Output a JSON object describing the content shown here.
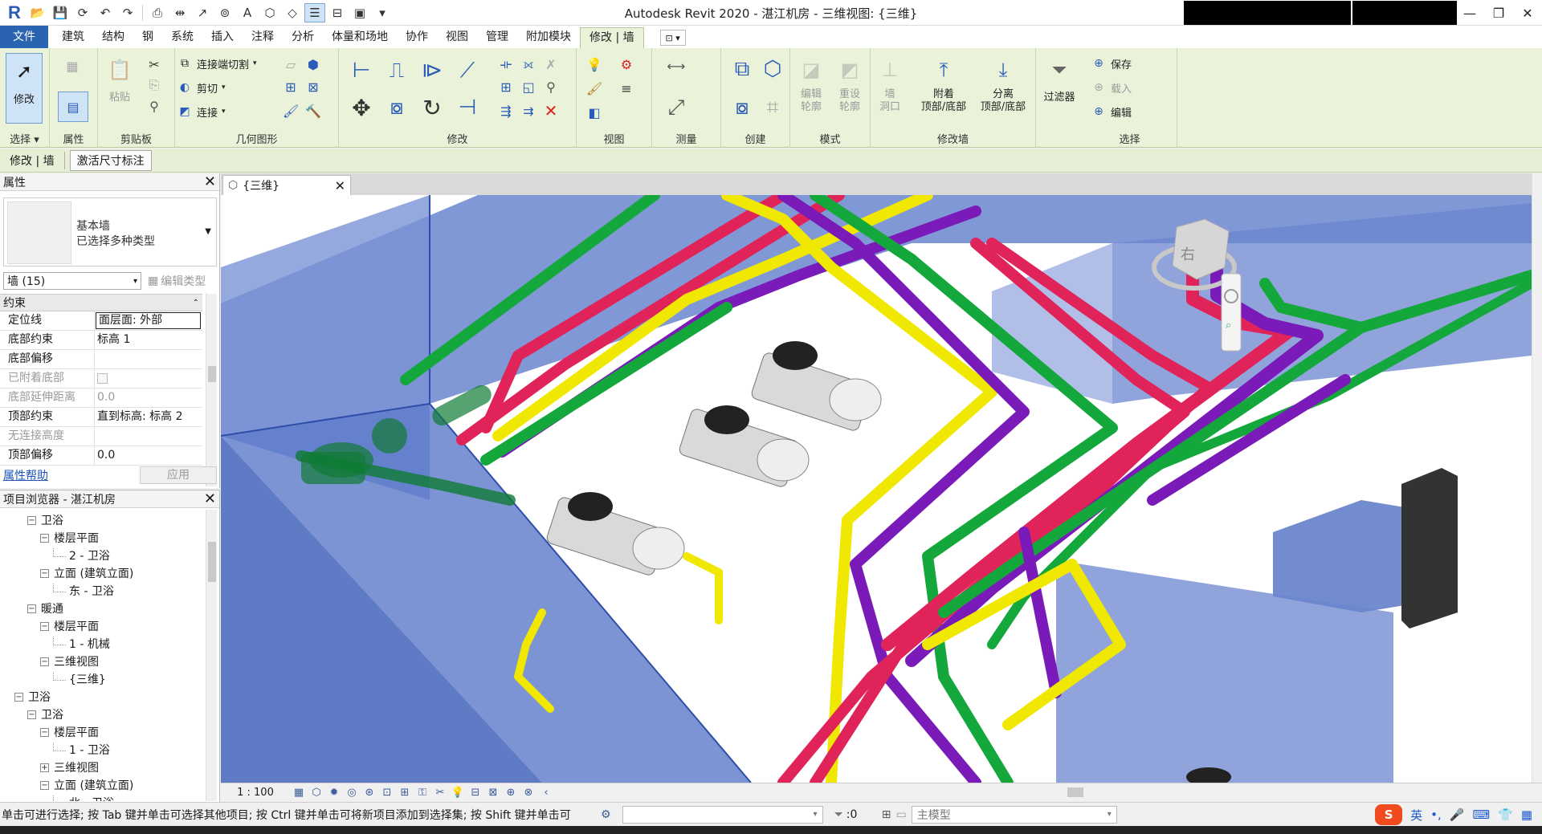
{
  "app": {
    "title": "Autodesk Revit 2020 - 湛江机房 - 三维视图: {三维}"
  },
  "quick_access": {
    "icons": [
      "revit-logo",
      "open-icon",
      "save-icon",
      "sync-icon",
      "undo-icon",
      "redo-icon",
      "print-icon",
      "measure-icon",
      "dimension-icon",
      "tag-icon",
      "text-icon",
      "3d-view-icon",
      "section-icon",
      "thin-lines-icon",
      "close-hidden-icon",
      "switch-windows-icon",
      "customize-icon"
    ],
    "text_glyph": "A"
  },
  "window_controls": {
    "minimize": "—",
    "restore": "❐",
    "close": "✕"
  },
  "tabs": [
    "文件",
    "建筑",
    "结构",
    "钢",
    "系统",
    "插入",
    "注释",
    "分析",
    "体量和场地",
    "协作",
    "视图",
    "管理",
    "附加模块",
    "修改 | 墙"
  ],
  "tabs_selected_index": 13,
  "tab_extra": "⊡ ▾",
  "ribbon": {
    "select": {
      "modify_label": "修改",
      "panel_label": "选择 ▾"
    },
    "properties": {
      "panel_label": "属性"
    },
    "clipboard": {
      "paste_label": "粘贴",
      "panel_label": "剪贴板"
    },
    "geometry": {
      "join_cut_label": "连接端切割",
      "cut_label": "剪切",
      "join_label": "连接",
      "panel_label": "几何图形"
    },
    "modify": {
      "panel_label": "修改"
    },
    "view": {
      "panel_label": "视图"
    },
    "measure": {
      "panel_label": "测量"
    },
    "create": {
      "panel_label": "创建"
    },
    "mode": {
      "edit_profile_label": "编辑\n轮廓",
      "reset_profile_label": "重设\n轮廓",
      "panel_label": "模式"
    },
    "modify_wall": {
      "wall_opening_label": "墙\n洞口",
      "attach_label": "附着\n顶部/底部",
      "detach_label": "分离\n顶部/底部",
      "panel_label": "修改墙"
    },
    "filter": {
      "filter_label": "过滤器"
    },
    "selection": {
      "save_label": "保存",
      "load_label": "载入",
      "edit_label": "编辑",
      "panel_label": "选择"
    }
  },
  "context_bar": {
    "label": "修改 | 墙",
    "activate_dimensions": "激活尺寸标注"
  },
  "properties": {
    "title": "属性",
    "type_name_line1": "基本墙",
    "type_name_line2": "已选择多种类型",
    "instance_filter": "墙 (15)",
    "edit_type": "编辑类型",
    "group": "约束",
    "rows": [
      {
        "key": "定位线",
        "value": "面层面: 外部"
      },
      {
        "key": "底部约束",
        "value": "标高 1"
      },
      {
        "key": "底部偏移",
        "value": ""
      },
      {
        "key": "已附着底部",
        "value": ""
      },
      {
        "key": "底部延伸距离",
        "value": "0.0"
      },
      {
        "key": "顶部约束",
        "value": "直到标高: 标高 2"
      },
      {
        "key": "无连接高度",
        "value": ""
      },
      {
        "key": "顶部偏移",
        "value": "0.0"
      }
    ],
    "help_link": "属性帮助",
    "apply": "应用"
  },
  "project_browser": {
    "title": "项目浏览器 - 湛江机房",
    "items": [
      {
        "label": "卫浴",
        "box": "−"
      },
      {
        "label": "楼层平面",
        "box": "−"
      },
      {
        "label": "2 - 卫浴",
        "box": ""
      },
      {
        "label": "立面 (建筑立面)",
        "box": "−"
      },
      {
        "label": "东 - 卫浴",
        "box": ""
      },
      {
        "label": "暖通",
        "box": "−"
      },
      {
        "label": "楼层平面",
        "box": "−"
      },
      {
        "label": "1 - 机械",
        "box": ""
      },
      {
        "label": "三维视图",
        "box": "−"
      },
      {
        "label": "{三维}",
        "box": ""
      },
      {
        "label": "卫浴",
        "box": "−"
      },
      {
        "label": "卫浴",
        "box": "−"
      },
      {
        "label": "楼层平面",
        "box": "−"
      },
      {
        "label": "1 - 卫浴",
        "box": ""
      },
      {
        "label": "三维视图",
        "box": "+"
      },
      {
        "label": "立面 (建筑立面)",
        "box": "−"
      },
      {
        "label": "北 - 卫浴",
        "box": ""
      }
    ]
  },
  "view_tab": {
    "label": "{三维}"
  },
  "viewcube": {
    "face": "右"
  },
  "view_control": {
    "scale": "1 : 100"
  },
  "status": {
    "message": "单击可进行选择; 按 Tab 键并单击可选择其他项目; 按 Ctrl 键并单击可将新项目添加到选择集; 按 Shift 键并单击可",
    "selected_count": ":0",
    "model": "主模型"
  },
  "ime": {
    "brand": "S",
    "lang": "英"
  },
  "colors": {
    "ribbon_bg": "#eaf2d9",
    "file_tab": "#2a63b0",
    "wall_blue": "#5b78c8",
    "pipe_green": "#14a83c",
    "pipe_red": "#e0245a",
    "pipe_yellow": "#f0e800",
    "pipe_purple": "#7a1ab8",
    "pipe_dark_green": "#0f7a34"
  }
}
